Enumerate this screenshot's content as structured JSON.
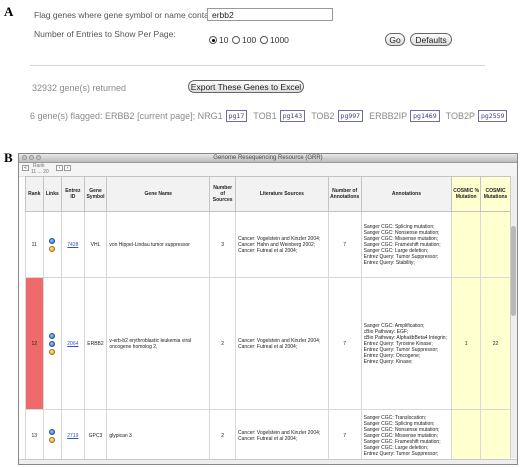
{
  "panel_a": {
    "letter": "A",
    "flag_label": "Flag genes where gene symbol or name contains:",
    "flag_value": "erbb2",
    "entries_label": "Number of Entries to Show Per Page:",
    "radio_options": [
      "10",
      "100",
      "1000"
    ],
    "radio_selected": "10",
    "go_label": "Go",
    "defaults_label": "Defaults",
    "returned_text": "32932 gene(s) returned",
    "export_label": "Export These Genes to Excel",
    "flagged_prefix": "6 gene(s) flagged: ERBB2 [current page]; NRG1",
    "flagged_items": [
      {
        "page": "pg17",
        "next": "TOB1"
      },
      {
        "page": "pg143",
        "next": "TOB2"
      },
      {
        "page": "pg997",
        "next": "ERBB2IP"
      },
      {
        "page": "pg1469",
        "next": "TOB2P"
      },
      {
        "page": "pg2559",
        "next": ""
      }
    ]
  },
  "panel_b": {
    "letter": "B",
    "window_title": "Genome Resequencing Resource (GRR)",
    "rank_label": "Rank",
    "rank_range": "11 ... 20",
    "columns": [
      "Rank",
      "Links",
      "Entrez ID",
      "Gene Symbol",
      "Gene Name",
      "Number of Sources",
      "Literature Sources",
      "Number of Annotations",
      "Annotations",
      "COSMIC % Mutation",
      "COSMIC Mutations"
    ],
    "rows": [
      {
        "rank": "11",
        "entrez": "7428",
        "symbol": "VHL",
        "name": "von Hippel-Lindau tumor suppressor",
        "num_sources": "3",
        "literature": [
          "Cancer: Vogelstein and Kinzler 2004;",
          "Cancer: Hahn and Weinberg 2002;",
          "Cancer: Futreal et al 2004;"
        ],
        "num_annotations": "7",
        "annotations": [
          "Sanger CGC: Splicing mutation;",
          "Sanger CGC: Nonsense mutation;",
          "Sanger CGC: Missense mutation;",
          "Sanger CGC: Frameshift mutation;",
          "Sanger CGC: Large deletion;",
          "Entrez Query: Tumor Suppressor;",
          "Entrez Query: Stability;"
        ],
        "cosmic_pct": "",
        "cosmic_mut": ""
      },
      {
        "rank": "12",
        "entrez": "2064",
        "symbol": "ERBB2",
        "name": "v-erb-b2 erythroblastic leukemia viral oncogene homolog 2,",
        "num_sources": "2",
        "literature": [
          "Cancer: Vogelstein and Kinzler 2004;",
          "Cancer: Futreal et al 2004;"
        ],
        "num_annotations": "7",
        "annotations": [
          "Sanger CGC: Amplification;",
          "cBio Pathway: EGF;",
          "cBio Pathway: AlphaⅡbBeta4 Integrin;",
          "Entrez Query: Tyrosine Kinase;",
          "Entrez Query: Tumor Suppressor;",
          "Entrez Query: Oncogene;",
          "Entrez Query: Kinase;"
        ],
        "cosmic_pct": "1",
        "cosmic_mut": "22"
      },
      {
        "rank": "13",
        "entrez": "2719",
        "symbol": "GPC3",
        "name": "glypican 3",
        "num_sources": "2",
        "literature": [
          "Cancer: Vogelstein and Kinzler 2004;",
          "Cancer: Futreal et al 2004;"
        ],
        "num_annotations": "7",
        "annotations": [
          "Sanger CGC: Translocation;",
          "Sanger CGC: Splicing mutation;",
          "Sanger CGC: Nonsense mutation;",
          "Sanger CGC: Missense mutation;",
          "Sanger CGC: Frameshift mutation;",
          "Sanger CGC: Large deletion;",
          "Entrez Query: Tumor Suppressor;"
        ],
        "cosmic_pct": "",
        "cosmic_mut": ""
      }
    ]
  },
  "colors": {
    "highlight_row": "#ef6a6a",
    "cosmic_bg": "#ffffcf",
    "link": "#3355bb"
  }
}
